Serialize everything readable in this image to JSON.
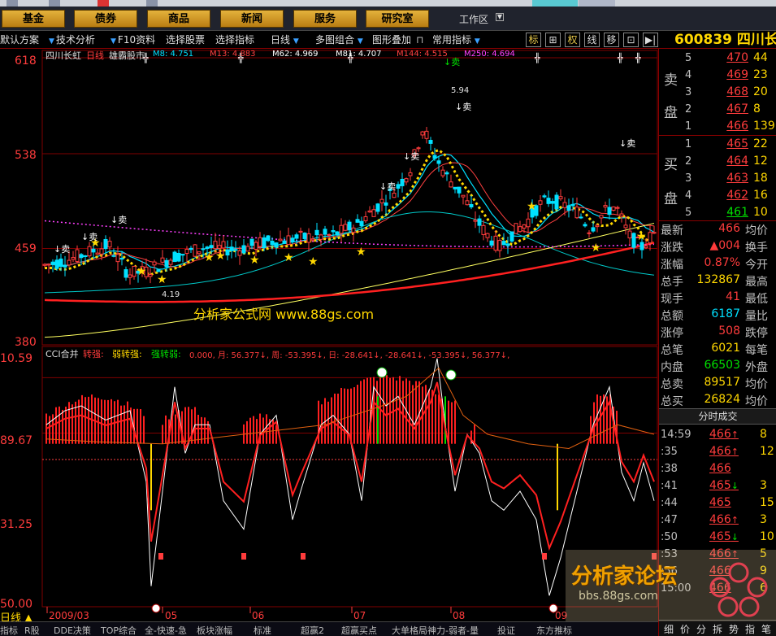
{
  "nav": {
    "buttons": [
      "基金",
      "债券",
      "商品",
      "新闻",
      "服务",
      "研究室"
    ],
    "workspace": "工作区"
  },
  "toolbar": {
    "items": [
      "默认方案",
      "技术分析",
      "F10资料",
      "选择股票",
      "选择指标",
      "日线",
      "多图组合",
      "图形叠加",
      "常用指标"
    ],
    "icons": [
      "标",
      "⊞",
      "权",
      "线",
      "移",
      "⊡",
      "▶|"
    ],
    "stock": "600839 四川长"
  },
  "kline": {
    "header": "四川长虹",
    "period": "日线",
    "indicator": "雄霸股市",
    "mas": [
      {
        "label": "M8: 4.751",
        "color": "#00e0ff"
      },
      {
        "label": "M13: 4.883",
        "color": "#ff4040"
      },
      {
        "label": "M62: 4.969",
        "color": "#ffffff"
      },
      {
        "label": "M81: 4.707",
        "color": "#ffffff"
      },
      {
        "label": "M144: 4.515",
        "color": "#ff4040"
      },
      {
        "label": "M250: 4.694",
        "color": "#ff40ff"
      }
    ],
    "y_ticks": [
      "618",
      "538",
      "459",
      "380"
    ],
    "high_label": "5.94",
    "low_label": "4.19",
    "sell_label": "卖",
    "sell_top_label": "↓卖"
  },
  "cci": {
    "title": "CCI合并",
    "labels": [
      {
        "t": "转强:",
        "c": "#ff3c3c"
      },
      {
        "t": "弱转强:",
        "c": "#ffd700"
      },
      {
        "t": "强转弱:",
        "c": "#00e000"
      },
      {
        "t": "0.000, 月: 56.377↓, 周: -53.395↓, 日: -28.641↓, -28.641↓, -53.395↓, 56.377↓,",
        "c": "#ff3c3c"
      }
    ],
    "y_ticks": [
      "10.59",
      "89.67",
      "31.25",
      "50.00"
    ]
  },
  "dates": [
    "2009/03",
    "05",
    "06",
    "07",
    "08",
    "09"
  ],
  "period_tab": "日线",
  "orderbook": {
    "sell_label": [
      "卖",
      "盘"
    ],
    "buy_label": [
      "买",
      "盘"
    ],
    "sells": [
      {
        "lvl": "5",
        "price": "470",
        "vol": "44"
      },
      {
        "lvl": "4",
        "price": "469",
        "vol": "23"
      },
      {
        "lvl": "3",
        "price": "468",
        "vol": "20"
      },
      {
        "lvl": "2",
        "price": "467",
        "vol": "8"
      },
      {
        "lvl": "1",
        "price": "466",
        "vol": "139"
      }
    ],
    "buys": [
      {
        "lvl": "1",
        "price": "465",
        "vol": "22"
      },
      {
        "lvl": "2",
        "price": "464",
        "vol": "12"
      },
      {
        "lvl": "3",
        "price": "463",
        "vol": "18"
      },
      {
        "lvl": "4",
        "price": "462",
        "vol": "16"
      },
      {
        "lvl": "5",
        "price": "461",
        "vol": "10"
      }
    ]
  },
  "stats": [
    {
      "l": "最新",
      "v": "466",
      "vc": "#ff3c3c",
      "r": "均价"
    },
    {
      "l": "涨跌",
      "v": "▲004",
      "vc": "#ff3c3c",
      "r": "换手"
    },
    {
      "l": "涨幅",
      "v": "0.87%",
      "vc": "#ff3c3c",
      "r": "今开"
    },
    {
      "l": "总手",
      "v": "132867",
      "vc": "#ffd700",
      "r": "最高"
    },
    {
      "l": "现手",
      "v": "41",
      "vc": "#ff3c3c",
      "r": "最低"
    },
    {
      "l": "总额",
      "v": "6187",
      "vc": "#00e0ff",
      "r": "量比"
    },
    {
      "l": "涨停",
      "v": "508",
      "vc": "#ff3c3c",
      "r": "跌停"
    },
    {
      "l": "总笔",
      "v": "6021",
      "vc": "#ffd700",
      "r": "每笔"
    },
    {
      "l": "内盘",
      "v": "66503",
      "vc": "#00e000",
      "r": "外盘"
    },
    {
      "l": "总卖",
      "v": "89517",
      "vc": "#ffd700",
      "r": "均价"
    },
    {
      "l": "总买",
      "v": "26824",
      "vc": "#ffd700",
      "r": "均价"
    }
  ],
  "ticks_title": "分时成交",
  "ticks": [
    {
      "t": "14:59",
      "p": "466",
      "a": "↑",
      "ac": "#ff3c3c",
      "v": "8"
    },
    {
      "t": ":35",
      "p": "466",
      "a": "↑",
      "ac": "#ff3c3c",
      "v": "12"
    },
    {
      "t": ":38",
      "p": "466",
      "a": "",
      "ac": "#ff3c3c",
      "v": ""
    },
    {
      "t": ":41",
      "p": "465",
      "a": "↓",
      "ac": "#00e000",
      "v": "3"
    },
    {
      "t": ":44",
      "p": "465",
      "a": "",
      "ac": "#00e000",
      "v": "15"
    },
    {
      "t": ":47",
      "p": "466",
      "a": "↑",
      "ac": "#ff3c3c",
      "v": "3"
    },
    {
      "t": ":50",
      "p": "465",
      "a": "↓",
      "ac": "#00e000",
      "v": "10"
    },
    {
      "t": ":53",
      "p": "466",
      "a": "↑",
      "ac": "#ff3c3c",
      "v": "5"
    },
    {
      "t": ":56",
      "p": "466",
      "a": "",
      "ac": "#ff3c3c",
      "v": "9"
    },
    {
      "t": "15:00",
      "p": "466",
      "a": "",
      "ac": "#ff3c3c",
      "v": "6"
    }
  ],
  "right_tabs": [
    "细",
    "价",
    "分",
    "拆",
    "势",
    "指",
    "笔"
  ],
  "bottom_tabs": [
    "指标",
    "R股",
    "DDE决策",
    "TOP综合",
    "全-快速-急",
    "板块涨幅",
    "标准",
    "超赢2",
    "超赢买点",
    "大单格局神力-弱者-量",
    "投证",
    "东方推标"
  ],
  "watermark": {
    "site": "分析家公式网 www.88gs.com",
    "forum": "分析家论坛",
    "url": "bbs.88gs.com"
  }
}
